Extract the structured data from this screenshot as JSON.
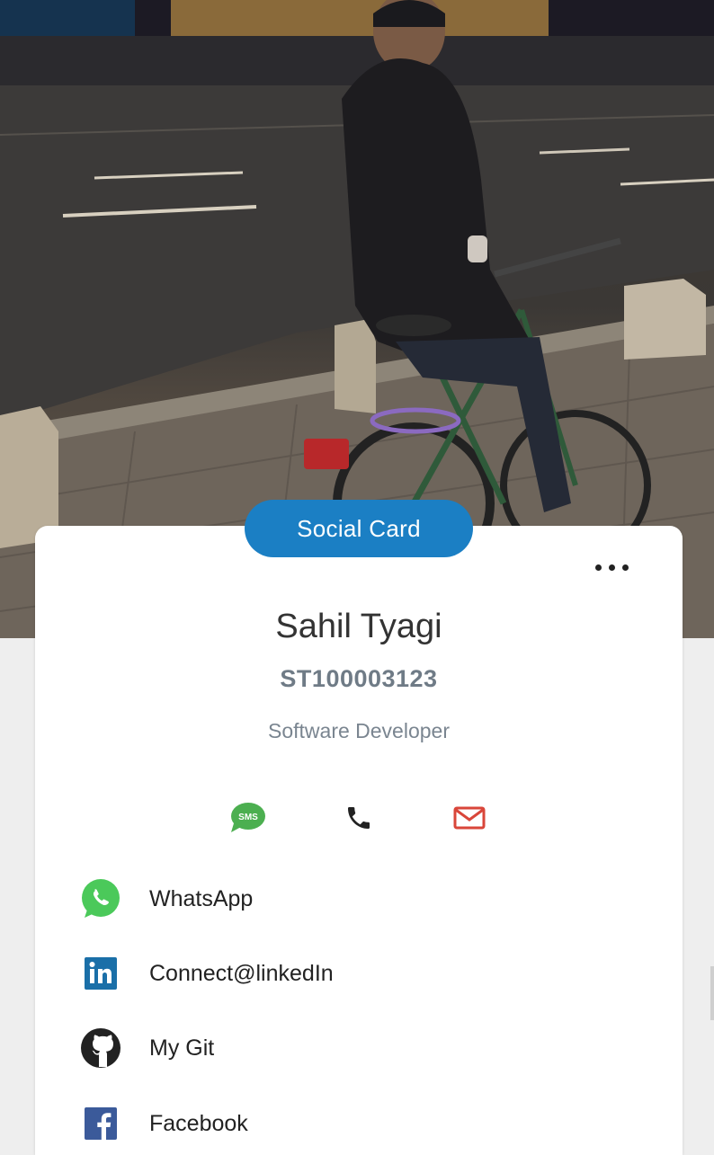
{
  "card": {
    "badge_label": "Social Card",
    "more_icon": "more-horizontal-icon",
    "name": "Sahil Tyagi",
    "id_code": "ST100003123",
    "title": "Software Developer"
  },
  "quick_actions": [
    {
      "name": "sms",
      "icon": "sms-icon",
      "color": "#4caf50",
      "label": "SMS"
    },
    {
      "name": "call",
      "icon": "phone-icon",
      "color": "#222222"
    },
    {
      "name": "email",
      "icon": "mail-icon",
      "color": "#d9463a"
    }
  ],
  "links": [
    {
      "label": "WhatsApp",
      "icon": "whatsapp-icon",
      "color": "#4bc95a"
    },
    {
      "label": "Connect@linkedIn",
      "icon": "linkedin-icon",
      "color": "#1a6fa8"
    },
    {
      "label": "My Git",
      "icon": "github-icon",
      "color": "#222222"
    },
    {
      "label": "Facebook",
      "icon": "facebook-icon",
      "color": "#3b5a9a"
    }
  ],
  "colors": {
    "accent": "#1b7fc4",
    "id_text": "#6f7b86",
    "background": "#eeeeee"
  }
}
